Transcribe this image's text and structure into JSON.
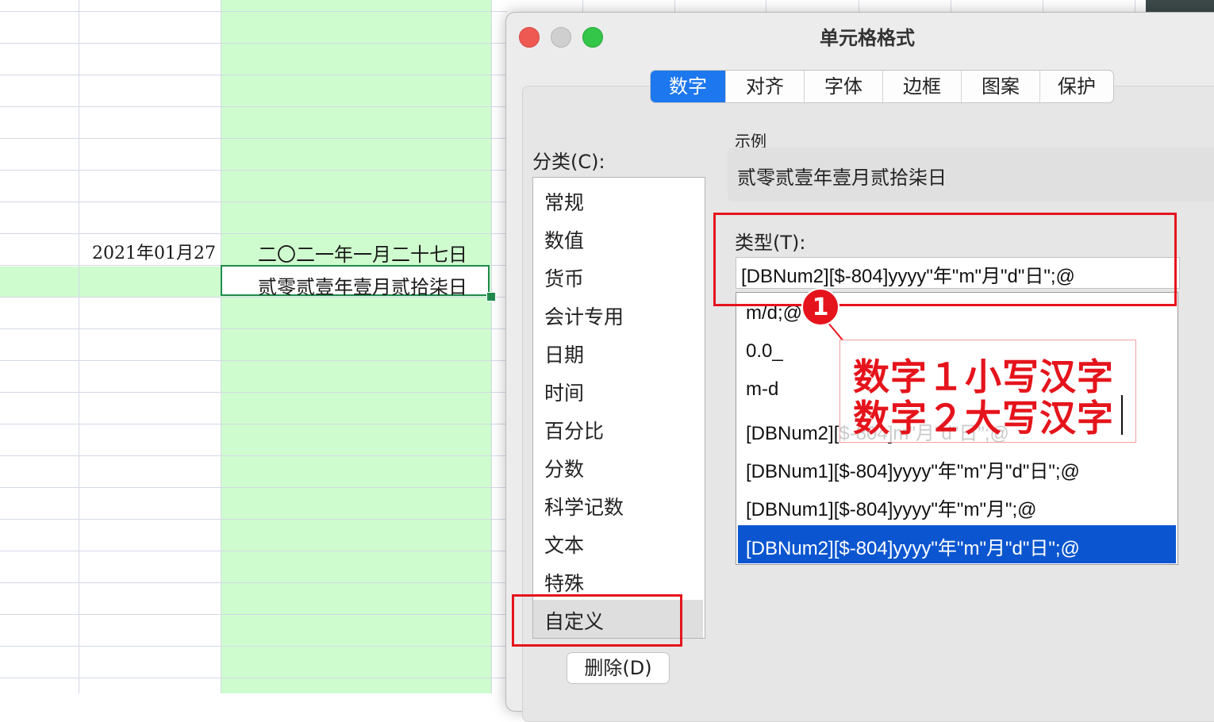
{
  "spreadsheet": {
    "b_row8": "2021年01月27",
    "c_row8": "二〇二一年一月二十七日",
    "c_row9": "贰零贰壹年壹月贰拾柒日"
  },
  "dialog": {
    "title": "单元格格式",
    "tabs": [
      "数字",
      "对齐",
      "字体",
      "边框",
      "图案",
      "保护"
    ],
    "active_tab": "数字",
    "category_label": "分类(C):",
    "categories": [
      "常规",
      "数值",
      "货币",
      "会计专用",
      "日期",
      "时间",
      "百分比",
      "分数",
      "科学记数",
      "文本",
      "特殊",
      "自定义"
    ],
    "selected_category": "自定义",
    "delete_button": "删除(D)",
    "sample_label": "示例",
    "sample_value": "贰零贰壹年壹月贰拾柒日",
    "type_label": "类型(T):",
    "type_value": "[DBNum2][$-804]yyyy\"年\"m\"月\"d\"日\";@",
    "format_list": [
      "m/d;@",
      "0.0_",
      "m-d",
      "[DBNum2][$-804]m\"月\"d\"日\";@",
      "[DBNum1][$-804]yyyy\"年\"m\"月\"d\"日\";@",
      "[DBNum1][$-804]yyyy\"年\"m\"月\";@",
      "[DBNum2][$-804]yyyy\"年\"m\"月\"d\"日\";@"
    ],
    "selected_format_index": 6
  },
  "annotation": {
    "badge": "1",
    "line1": "数字１小写汉字",
    "line2": "数字２大写汉字",
    "color": "#e5141c"
  },
  "colors": {
    "highlight_green": "#cffccf",
    "accent_blue": "#1d77ee",
    "selection_blue": "#0b56d0",
    "active_cell_border": "#1f8a4c"
  }
}
